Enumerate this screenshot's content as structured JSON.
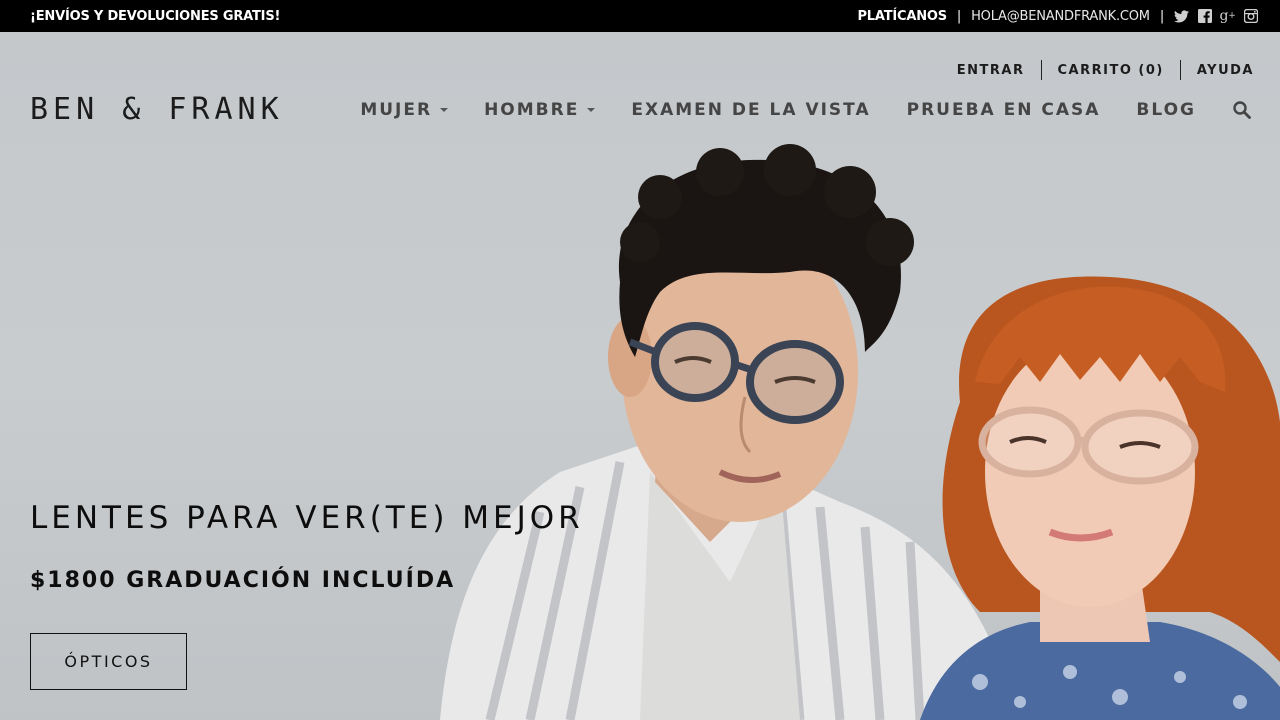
{
  "topbar": {
    "promo": "¡ENVÍOS Y DEVOLUCIONES GRATIS!",
    "chat_label": "PLATÍCANOS",
    "email": "HOLA@BENANDFRANK.COM",
    "separator": "|",
    "social_icons": [
      "twitter-icon",
      "facebook-icon",
      "google-plus-icon",
      "instagram-icon"
    ]
  },
  "header": {
    "logo": "BEN & FRANK",
    "utility_nav": [
      "ENTRAR",
      "CARRITO (0)",
      "AYUDA"
    ],
    "main_nav": [
      {
        "label": "MUJER",
        "has_dropdown": true
      },
      {
        "label": "HOMBRE",
        "has_dropdown": true
      },
      {
        "label": "EXAMEN DE LA VISTA",
        "has_dropdown": false
      },
      {
        "label": "PRUEBA EN CASA",
        "has_dropdown": false
      },
      {
        "label": "BLOG",
        "has_dropdown": false
      }
    ],
    "search_icon": "search-icon"
  },
  "hero": {
    "headline": "LENTES PARA VER(TE) MEJOR",
    "subline": "$1800 GRADUACIÓN INCLUÍDA",
    "cta_label": "ÓPTICOS",
    "background_color": "#c8ccce"
  }
}
